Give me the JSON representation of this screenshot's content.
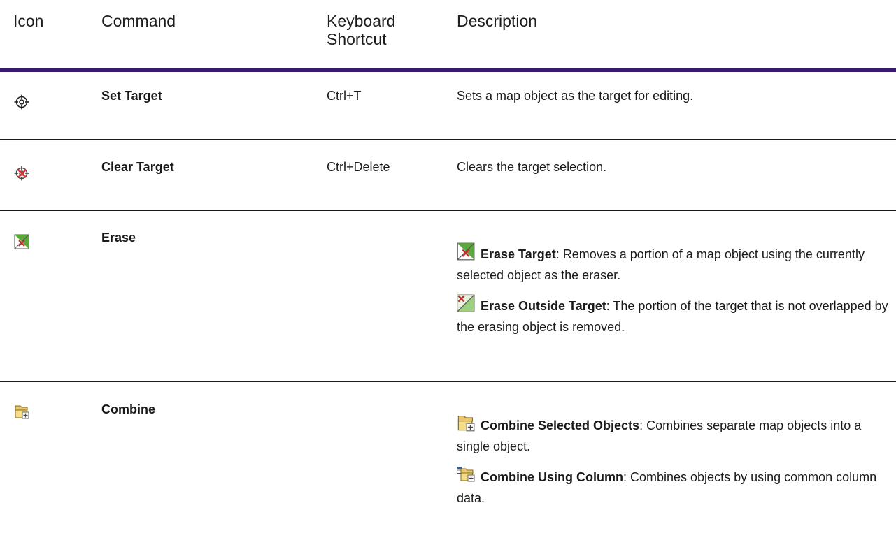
{
  "table": {
    "headers": {
      "icon": "Icon",
      "command": "Command",
      "shortcut_line1": "Keyboard",
      "shortcut_line2": "Shortcut",
      "description": "Description"
    },
    "rows": [
      {
        "icon": "target-icon",
        "command": "Set Target",
        "shortcut": "Ctrl+T",
        "description": "Sets a map object as the target for editing."
      },
      {
        "icon": "clear-target-icon",
        "command": "Clear Target",
        "shortcut": "Ctrl+Delete",
        "description": "Clears the target selection."
      },
      {
        "icon": "erase-icon",
        "command": "Erase",
        "shortcut": "",
        "items": [
          {
            "icon": "erase-target-icon",
            "title": "Erase Target",
            "text": ": Removes a portion of a map object using the currently selected object as the eraser."
          },
          {
            "icon": "erase-outside-target-icon",
            "title": "Erase Outside Target",
            "text": ": The portion of the target that is not overlapped by the erasing object is removed."
          }
        ]
      },
      {
        "icon": "combine-icon",
        "command": "Combine",
        "shortcut": "",
        "items": [
          {
            "icon": "combine-selected-objects-icon",
            "title": "Combine Selected Objects",
            "text": ": Combines separate map objects into a single object."
          },
          {
            "icon": "combine-using-column-icon",
            "title": "Combine Using Column",
            "text": ": Combines objects by using common column data."
          }
        ]
      }
    ]
  },
  "colors": {
    "header_rule": "#3a1a6b",
    "row_rule": "#1a1a1a"
  }
}
